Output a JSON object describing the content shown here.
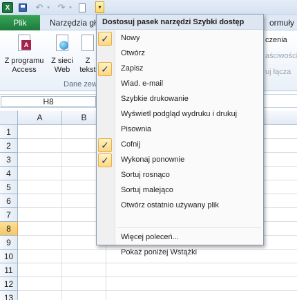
{
  "qat": {
    "excel_icon_text": "X",
    "customize_glyph": "▾"
  },
  "tabs": {
    "file": "Plik",
    "items": [
      "Narzędzia gł",
      "ormuły"
    ]
  },
  "ribbon": {
    "buttons": [
      {
        "line1": "Z programu",
        "line2": "Access",
        "icon": "access-database-icon"
      },
      {
        "line1": "Z sieci",
        "line2": "Web",
        "icon": "web-globe-icon"
      },
      {
        "line1": "Z",
        "line2": "tekst",
        "icon": "text-file-icon"
      }
    ],
    "group_label": "Dane zew",
    "side_items": [
      "czenia",
      "aściwości",
      "uj łącza"
    ]
  },
  "formula_bar": {
    "name_box": "H8"
  },
  "grid": {
    "columns": [
      "A",
      "B"
    ],
    "rows": [
      "1",
      "2",
      "3",
      "4",
      "5",
      "6",
      "7",
      "8",
      "9",
      "10",
      "11",
      "12",
      "13"
    ],
    "active_row": "8"
  },
  "menu": {
    "title": "Dostosuj pasek narzędzi Szybki dostęp",
    "items": [
      {
        "label": "Nowy",
        "checked": true
      },
      {
        "label": "Otwórz",
        "checked": false
      },
      {
        "label": "Zapisz",
        "checked": true
      },
      {
        "label": "Wiad. e-mail",
        "checked": false
      },
      {
        "label": "Szybkie drukowanie",
        "checked": false
      },
      {
        "label": "Wyświetl podgląd wydruku i drukuj",
        "checked": false
      },
      {
        "label": "Pisownia",
        "checked": false
      },
      {
        "label": "Cofnij",
        "checked": true
      },
      {
        "label": "Wykonaj ponownie",
        "checked": true
      },
      {
        "label": "Sortuj rosnąco",
        "checked": false
      },
      {
        "label": "Sortuj malejąco",
        "checked": false
      },
      {
        "label": "Otwórz ostatnio używany plik",
        "checked": false
      }
    ],
    "more_commands": "Więcej poleceń...",
    "show_below": "Pokaż poniżej Wstążki",
    "check_glyph": "✓"
  }
}
